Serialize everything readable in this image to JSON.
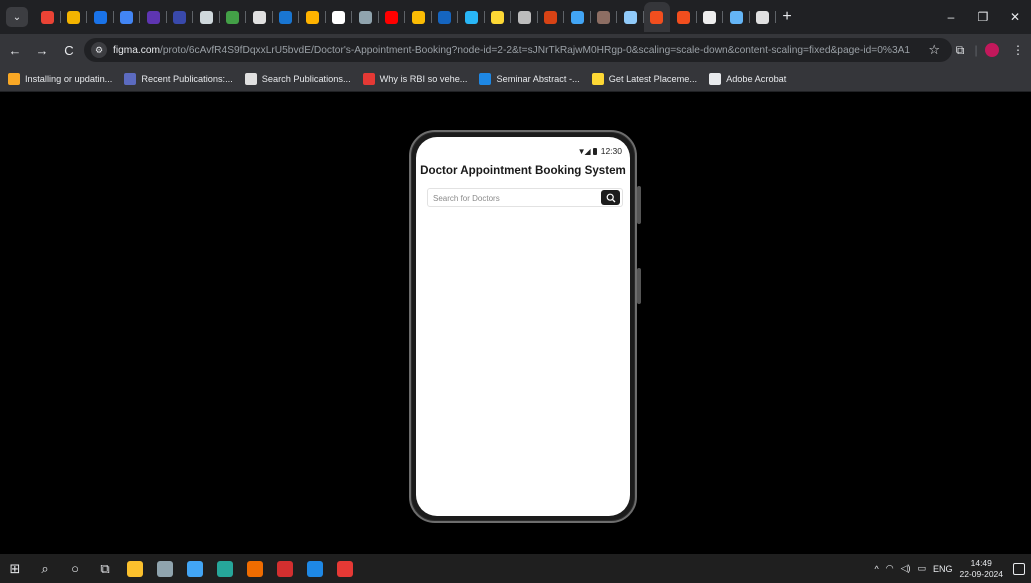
{
  "browser": {
    "tabs": [
      {
        "icon": "chevron-down-icon",
        "color": "#3c3d41"
      },
      {
        "icon": "gmail-icon",
        "color": "#ea4335"
      },
      {
        "icon": "site-icon-1",
        "color": "#f4b400"
      },
      {
        "icon": "site-icon-2",
        "color": "#1a73e8"
      },
      {
        "icon": "site-icon-3",
        "color": "#4285f4"
      },
      {
        "icon": "site-icon-4",
        "color": "#5e35b1"
      },
      {
        "icon": "site-icon-5",
        "color": "#3949ab"
      },
      {
        "icon": "site-icon-6",
        "color": "#cfd8dc"
      },
      {
        "icon": "site-icon-7",
        "color": "#43a047"
      },
      {
        "icon": "site-icon-8",
        "color": "#e0e0e0"
      },
      {
        "icon": "site-icon-9",
        "color": "#1976d2"
      },
      {
        "icon": "site-icon-10",
        "color": "#ffb300"
      },
      {
        "icon": "site-icon-11",
        "color": "#ffffff"
      },
      {
        "icon": "site-icon-12",
        "color": "#90a4ae"
      },
      {
        "icon": "youtube-icon",
        "color": "#ff0000"
      },
      {
        "icon": "drive-icon",
        "color": "#fbbc04"
      },
      {
        "icon": "site-icon-13",
        "color": "#1565c0"
      },
      {
        "icon": "site-icon-14",
        "color": "#29b6f6"
      },
      {
        "icon": "site-icon-15",
        "color": "#fdd835"
      },
      {
        "icon": "site-icon-16",
        "color": "#bdbdbd"
      },
      {
        "icon": "site-icon-17",
        "color": "#d84315"
      },
      {
        "icon": "site-icon-18",
        "color": "#42a5f5"
      },
      {
        "icon": "site-icon-19",
        "color": "#8d6e63"
      },
      {
        "icon": "site-icon-20",
        "color": "#90caf9"
      },
      {
        "icon": "figma-icon",
        "color": "#f24e1e",
        "active": true
      },
      {
        "icon": "figma-icon",
        "color": "#f24e1e"
      },
      {
        "icon": "site-icon-21",
        "color": "#eeeeee"
      },
      {
        "icon": "site-icon-22",
        "color": "#64b5f6"
      },
      {
        "icon": "github-icon",
        "color": "#e0e0e0"
      }
    ],
    "new_tab_label": "+",
    "window_controls": {
      "minimize": "–",
      "maximize": "❐",
      "close": "✕"
    },
    "nav": {
      "back": "←",
      "forward": "→",
      "reload": "C"
    },
    "url_host": "figma.com",
    "url_path": "/proto/6cAvfR4S9fDqxxLrU5bvdE/Doctor's-Appointment-Booking?node-id=2-2&t=sJNrTkRajwM0HRgp-0&scaling=scale-down&content-scaling=fixed&page-id=0%3A1",
    "star": "☆",
    "bookmarks": [
      {
        "label": "Installing or updatin...",
        "color": "#f9a825"
      },
      {
        "label": "Recent Publications:...",
        "color": "#5c6bc0"
      },
      {
        "label": "Search Publications...",
        "color": "#e0e0e0"
      },
      {
        "label": "Why is RBI so vehe...",
        "color": "#e53935"
      },
      {
        "label": "Seminar Abstract -...",
        "color": "#1e88e5"
      },
      {
        "label": "Get Latest Placeme...",
        "color": "#fdd835"
      },
      {
        "label": "Adobe Acrobat",
        "color": "#e8eaed"
      }
    ]
  },
  "phone": {
    "status_time": "12:30",
    "app_title": "Doctor Appointment Booking System",
    "search": {
      "placeholder": "Search for Doctors",
      "value": ""
    }
  },
  "taskbar": {
    "apps": [
      {
        "icon": "windows-start-icon",
        "color": "#e8eaed"
      },
      {
        "icon": "search-icon",
        "color": "#e8eaed"
      },
      {
        "icon": "cortana-icon",
        "color": "#e8eaed"
      },
      {
        "icon": "task-view-icon",
        "color": "#e8eaed"
      },
      {
        "icon": "file-explorer-icon",
        "color": "#fbc02d"
      },
      {
        "icon": "store-icon",
        "color": "#90a4ae"
      },
      {
        "icon": "mail-icon",
        "color": "#42a5f5"
      },
      {
        "icon": "edge-icon",
        "color": "#26a69a"
      },
      {
        "icon": "office-icon",
        "color": "#ef6c00"
      },
      {
        "icon": "acrobat-icon",
        "color": "#d32f2f"
      },
      {
        "icon": "word-icon",
        "color": "#1e88e5"
      },
      {
        "icon": "chrome-icon",
        "color": "#e53935"
      }
    ],
    "tray": {
      "language": "ENG",
      "time": "14:49",
      "date": "22-09-2024"
    }
  }
}
